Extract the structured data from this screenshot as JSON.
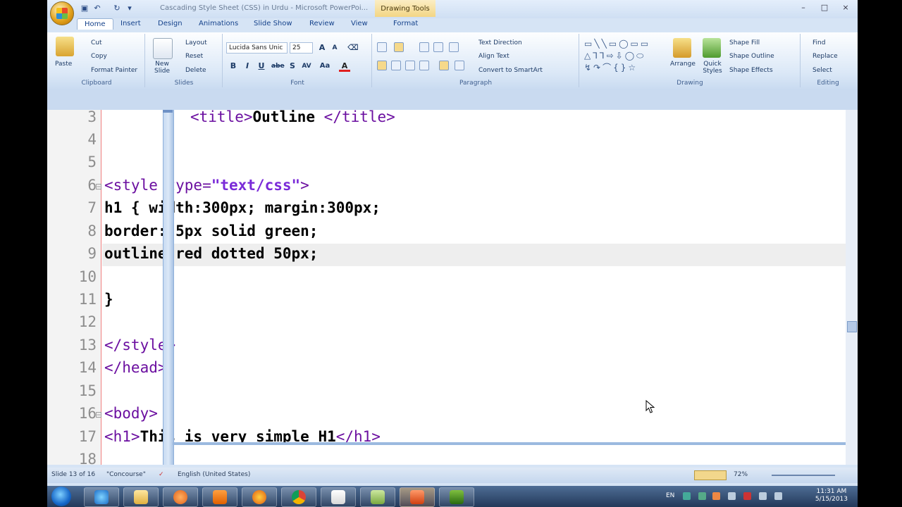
{
  "window": {
    "title": "Cascading Style Sheet (CSS) in Urdu - Microsoft PowerPoi...",
    "context_tab": "Drawing Tools",
    "controls": [
      "–",
      "□",
      "×"
    ]
  },
  "tabs": [
    "Home",
    "Insert",
    "Design",
    "Animations",
    "Slide Show",
    "Review",
    "View",
    "Format"
  ],
  "ribbon": {
    "clipboard": {
      "label": "Clipboard",
      "paste": "Paste",
      "cut": "Cut",
      "copy": "Copy",
      "format_painter": "Format Painter"
    },
    "slides": {
      "label": "Slides",
      "new_slide": "New Slide",
      "layout": "Layout",
      "reset": "Reset",
      "delete": "Delete"
    },
    "font": {
      "label": "Font",
      "font_name": "Lucida Sans Unic",
      "font_size": "25",
      "bold": "B",
      "italic": "I",
      "underline": "U",
      "strike": "abe",
      "shadow": "S",
      "spacing": "AV",
      "case": "Aa",
      "color": "A"
    },
    "paragraph": {
      "label": "Paragraph",
      "text_direction": "Text Direction",
      "align_text": "Align Text",
      "smartart": "Convert to SmartArt"
    },
    "drawing": {
      "label": "Drawing",
      "arrange": "Arrange",
      "quick_styles": "Quick Styles",
      "shape_fill": "Shape Fill",
      "shape_outline": "Shape Outline",
      "shape_effects": "Shape Effects"
    },
    "editing": {
      "label": "Editing",
      "find": "Find",
      "replace": "Replace",
      "select": "Select"
    }
  },
  "editor": {
    "line_numbers": [
      "3",
      "4",
      "5",
      "6",
      "7",
      "8",
      "9",
      "10",
      "11",
      "12",
      "13",
      "14",
      "15",
      "16",
      "17",
      "18"
    ],
    "lines": {
      "l3a": "<title>",
      "l3b": "Outline ",
      "l3c": "</title>",
      "l6a": "<style type=",
      "l6b": "\"text/css\"",
      "l6c": ">",
      "l7": "h1 { width:300px; margin:300px;",
      "l8": "border: 5px solid green;",
      "l9": "outline:red dotted 50px;",
      "l11": "}",
      "l13": "</style>",
      "l14": "</head>",
      "l16": "<body>",
      "l17a": "<h1>",
      "l17b": "This is very simple H1",
      "l17c": "</h1>"
    }
  },
  "status": {
    "slide": "Slide 13 of 16",
    "theme": "\"Concourse\"",
    "language": "English (United States)",
    "zoom": "72%"
  },
  "taskbar": {
    "lang": "EN",
    "time": "11:31 AM",
    "date": "5/15/2013"
  }
}
